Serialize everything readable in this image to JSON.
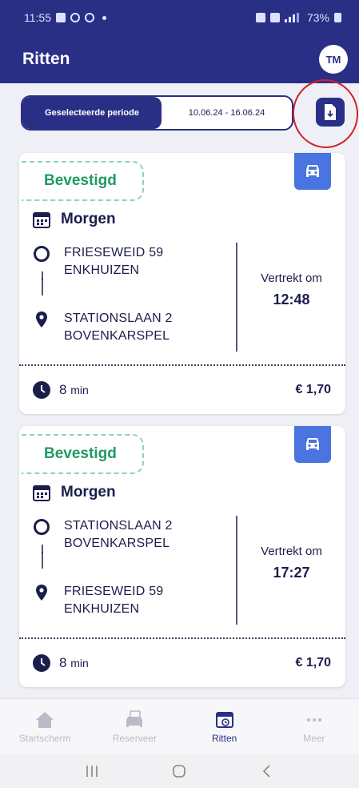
{
  "statusbar": {
    "time": "11:55",
    "battery": "73%"
  },
  "header": {
    "title": "Ritten",
    "avatar_initials": "TM"
  },
  "period": {
    "label": "Geselecteerde periode",
    "range": "10.06.24 - 16.06.24"
  },
  "rides": [
    {
      "status": "Bevestigd",
      "day": "Morgen",
      "from": [
        "FRIESEWEID 59",
        "ENKHUIZEN"
      ],
      "to": [
        "STATIONSLAAN 2",
        "BOVENKARSPEL"
      ],
      "departs_label": "Vertrekt om",
      "departs_time": "12:48",
      "duration": "8",
      "duration_unit": "min",
      "price": "€ 1,70"
    },
    {
      "status": "Bevestigd",
      "day": "Morgen",
      "from": [
        "STATIONSLAAN 2",
        "BOVENKARSPEL"
      ],
      "to": [
        "FRIESEWEID 59",
        "ENKHUIZEN"
      ],
      "departs_label": "Vertrekt om",
      "departs_time": "17:27",
      "duration": "8",
      "duration_unit": "min",
      "price": "€ 1,70"
    }
  ],
  "nav": {
    "items": [
      {
        "label": "Startscherm",
        "icon": "home-icon"
      },
      {
        "label": "Reserveer",
        "icon": "car-book-icon"
      },
      {
        "label": "Ritten",
        "icon": "rides-calendar-icon",
        "active": true
      },
      {
        "label": "Meer",
        "icon": "more-dots-icon"
      }
    ]
  },
  "colors": {
    "primary": "#2a2f86",
    "accent": "#4a74e0",
    "confirmed": "#1f9a64",
    "annotation": "#d3202d"
  }
}
